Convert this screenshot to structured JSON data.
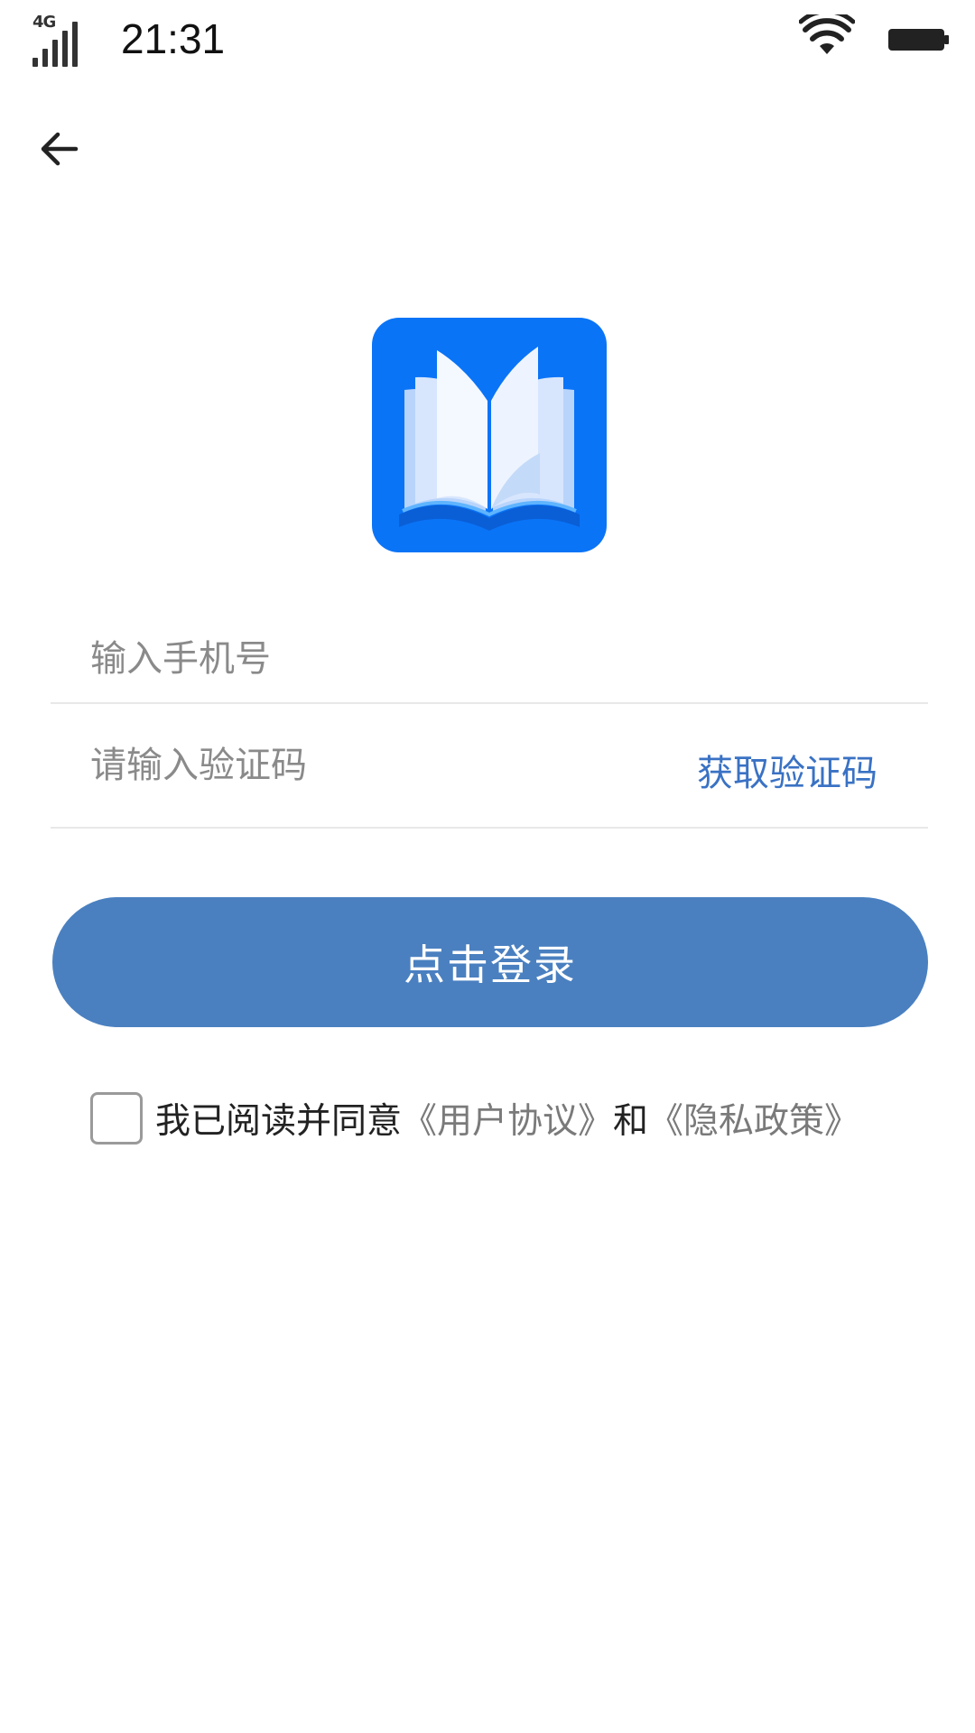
{
  "status_bar": {
    "network": "4G",
    "time": "21:31",
    "icons": [
      "signal-icon",
      "wifi-icon",
      "battery-icon"
    ]
  },
  "nav": {
    "back_icon": "arrow-left-icon"
  },
  "logo": {
    "icon": "open-book-icon",
    "background_color": "#0a74f7"
  },
  "form": {
    "phone_placeholder": "输入手机号",
    "phone_value": "",
    "code_placeholder": "请输入验证码",
    "code_value": "",
    "get_code_label": "获取验证码"
  },
  "login_button": {
    "label": "点击登录",
    "color": "#4a80c0"
  },
  "agreement": {
    "checked": false,
    "prefix": "我已阅读并同意",
    "user_agreement": "《用户协议》",
    "conjunction": "和",
    "privacy_policy": "《隐私政策》"
  },
  "colors": {
    "link": "#3a72c4",
    "muted_link": "#7a7a7a"
  }
}
